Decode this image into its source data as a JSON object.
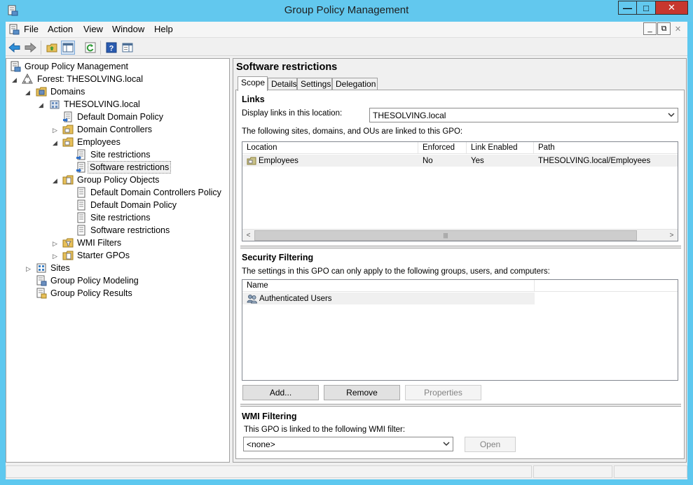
{
  "window": {
    "title": "Group Policy Management",
    "icon": "gpmc-app-icon",
    "minimize": "—",
    "maximize": "□",
    "close": "✕"
  },
  "menubar": {
    "items": [
      "File",
      "Action",
      "View",
      "Window",
      "Help"
    ],
    "mdi_minimize": "_",
    "mdi_restore": "⧉",
    "mdi_close": "✕"
  },
  "toolbar": {
    "buttons": [
      "back-icon",
      "forward-icon",
      "up-folder-icon",
      "show-hide-console-tree-icon",
      "refresh-icon",
      "help-icon",
      "show-action-pane-icon"
    ]
  },
  "tree": {
    "root": "Group Policy Management",
    "forest": "Forest: THESOLVING.local",
    "domains": "Domains",
    "domain": "THESOLVING.local",
    "default_domain_policy": "Default Domain Policy",
    "domain_controllers": "Domain Controllers",
    "employees": "Employees",
    "site_restrictions": "Site restrictions",
    "software_restrictions": "Software restrictions",
    "gpo": "Group Policy Objects",
    "gpo_items": [
      "Default Domain Controllers Policy",
      "Default Domain Policy",
      "Site restrictions",
      "Software restrictions"
    ],
    "wmi_filters": "WMI Filters",
    "starter_gpos": "Starter GPOs",
    "sites": "Sites",
    "modeling": "Group Policy Modeling",
    "results": "Group Policy Results"
  },
  "detail": {
    "title": "Software restrictions",
    "tabs": [
      "Scope",
      "Details",
      "Settings",
      "Delegation"
    ],
    "active_tab": "Scope",
    "links": {
      "heading": "Links",
      "location_label": "Display links in this location:",
      "location_value": "THESOLVING.local",
      "description": "The following sites, domains, and OUs are linked to this GPO:",
      "columns": [
        "Location",
        "Enforced",
        "Link Enabled",
        "Path"
      ],
      "rows": [
        {
          "location": "Employees",
          "enforced": "No",
          "link_enabled": "Yes",
          "path": "THESOLVING.local/Employees"
        }
      ],
      "scroll_left": "<",
      "scroll_right": ">",
      "thumb_grip": "|||"
    },
    "security": {
      "heading": "Security Filtering",
      "description": "The settings in this GPO can only apply to the following groups, users, and computers:",
      "columns": [
        "Name"
      ],
      "rows": [
        "Authenticated Users"
      ],
      "add": "Add...",
      "remove": "Remove",
      "properties": "Properties"
    },
    "wmi": {
      "heading": "WMI Filtering",
      "description": "This GPO is linked to the following WMI filter:",
      "value": "<none>",
      "open": "Open"
    }
  }
}
